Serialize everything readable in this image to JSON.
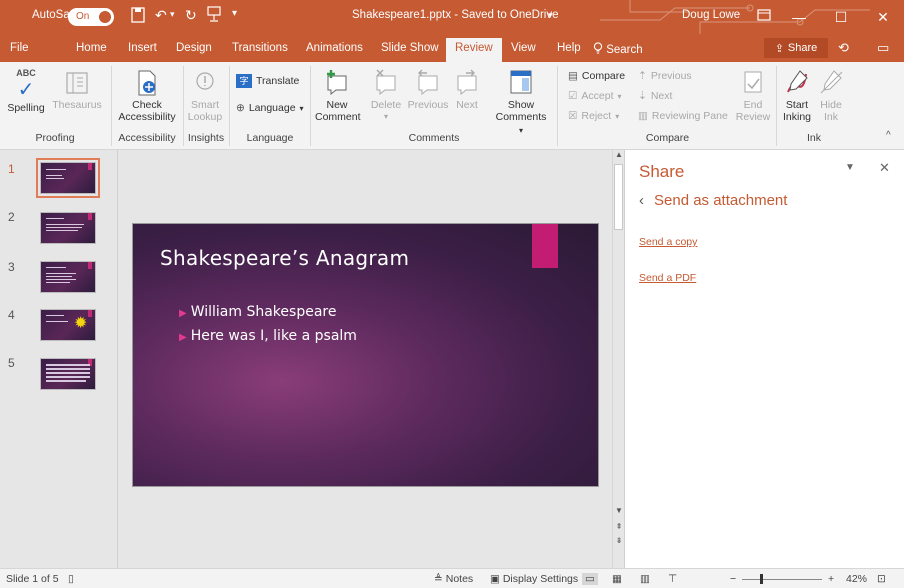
{
  "titlebar": {
    "autosave_label": "AutoSave",
    "autosave_state": "On",
    "doc_title": "Shakespeare1.pptx  -  Saved to OneDrive",
    "user_name": "Doug Lowe"
  },
  "tabs": {
    "items": [
      "File",
      "Home",
      "Insert",
      "Design",
      "Transitions",
      "Animations",
      "Slide Show",
      "Review",
      "View",
      "Help"
    ],
    "active": "Review",
    "search_label": "Search",
    "share_label": "Share"
  },
  "ribbon": {
    "proofing": {
      "spelling_icon_text": "ABC",
      "spelling": "Spelling",
      "thesaurus": "Thesaurus",
      "group": "Proofing"
    },
    "accessibility": {
      "check_line1": "Check",
      "check_line2": "Accessibility",
      "group": "Accessibility"
    },
    "insights": {
      "smart_line1": "Smart",
      "smart_line2": "Lookup",
      "group": "Insights"
    },
    "language": {
      "translate": "Translate",
      "language": "Language",
      "group": "Language"
    },
    "comments": {
      "new_line1": "New",
      "new_line2": "Comment",
      "delete": "Delete",
      "previous": "Previous",
      "next": "Next",
      "show_line1": "Show",
      "show_line2": "Comments",
      "group": "Comments"
    },
    "compare": {
      "compare": "Compare",
      "accept": "Accept",
      "reject": "Reject",
      "previous": "Previous",
      "next": "Next",
      "reviewing_pane": "Reviewing Pane",
      "end_line1": "End",
      "end_line2": "Review",
      "group": "Compare"
    },
    "ink": {
      "start_line1": "Start",
      "start_line2": "Inking",
      "hide_line1": "Hide",
      "hide_line2": "Ink",
      "group": "Ink"
    }
  },
  "thumbnails": [
    "1",
    "2",
    "3",
    "4",
    "5"
  ],
  "slide": {
    "title": "Shakespeare’s Anagram",
    "bullets": [
      "William Shakespeare",
      "Here was I, like a psalm"
    ]
  },
  "share_pane": {
    "title": "Share",
    "back_label": "Send as attachment",
    "send_copy": "Send a copy",
    "send_pdf": "Send a PDF"
  },
  "status": {
    "slide_info": "Slide 1 of 5",
    "notes": "Notes",
    "display_settings": "Display Settings",
    "zoom": "42%"
  },
  "colors": {
    "accent": "#c55a33",
    "slide_bg": "#4a2452",
    "slide_accent": "#c21d72"
  }
}
